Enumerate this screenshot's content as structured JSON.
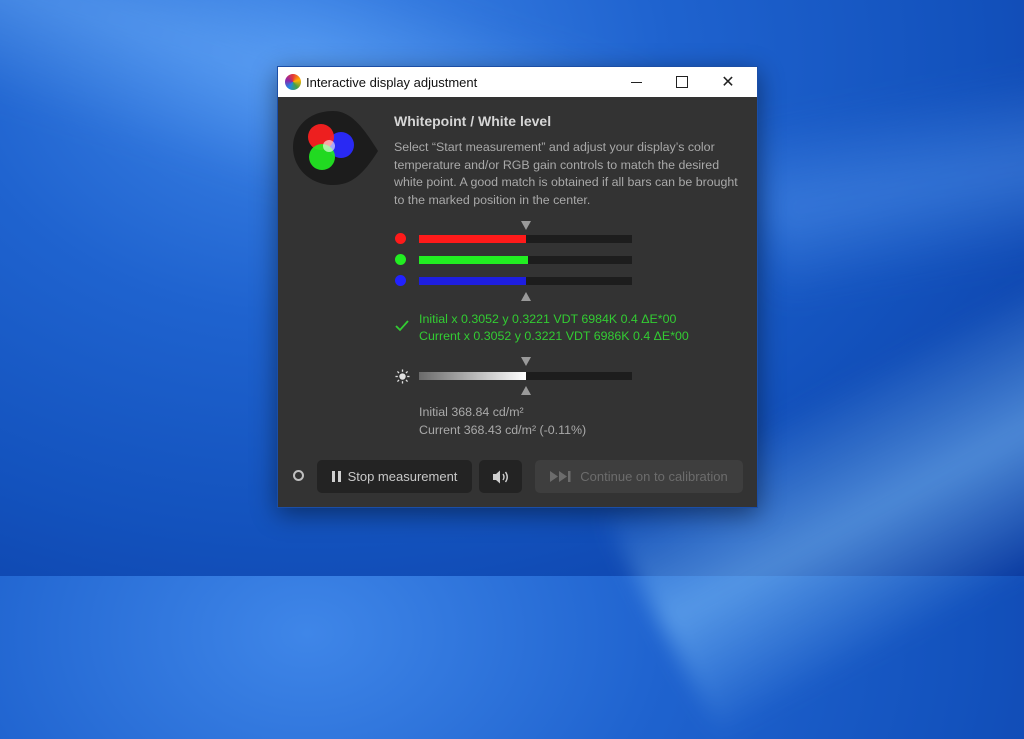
{
  "window": {
    "title": "Interactive display adjustment",
    "controls": {
      "minimize": "minimize",
      "maximize": "maximize",
      "close": "✕"
    }
  },
  "content": {
    "heading": "Whitepoint / White level",
    "description": "Select “Start measurement” and adjust your display’s color temperature and/or RGB gain controls to match the desired white point. A good match is obtained if all bars can be brought to the marked position in the center."
  },
  "rgb_bars": [
    {
      "channel": "red",
      "color": "#ff1a1a",
      "dot_color": "#ff1a1a",
      "level": 0.5
    },
    {
      "channel": "green",
      "color": "#22ee22",
      "dot_color": "#22ee22",
      "level": 0.51
    },
    {
      "channel": "blue",
      "color": "#1e1ee0",
      "dot_color": "#2222ff",
      "level": 0.5
    }
  ],
  "chromaticity": {
    "initial": "Initial x 0.3052 y 0.3221 VDT 6984K 0.4 ΔE*00",
    "current": "Current x 0.3052 y 0.3221 VDT 6986K 0.4 ΔE*00",
    "status_color": "#33cc33"
  },
  "luminance_bar": {
    "level": 0.5
  },
  "luminance": {
    "initial": "Initial 368.84 cd/m²",
    "current": "Current 368.43 cd/m² (-0.11%)"
  },
  "footer": {
    "stop_label": "Stop measurement",
    "continue_label": "Continue on to calibration"
  },
  "icons": [
    "app-icon",
    "rgb-logo-icon",
    "check-icon",
    "sun-icon",
    "pause-icon",
    "speaker-icon",
    "skip-forward-icon",
    "status-ring-icon"
  ]
}
